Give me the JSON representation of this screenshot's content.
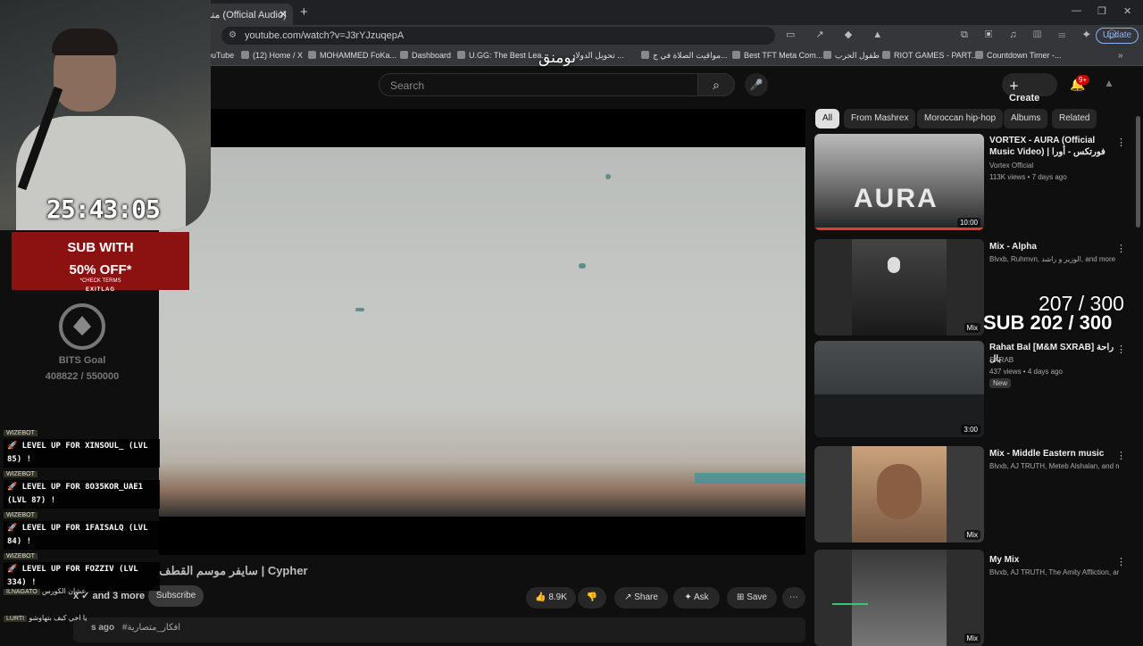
{
  "browser": {
    "tab_title": "متصارية (Official Audio)",
    "url": "youtube.com/watch?v=J3rYJzuqepA",
    "update_label": "Update",
    "bookmarks": [
      "ouTube",
      "(12) Home / X",
      "MOHAMMED FoKa...",
      "Dashboard",
      "U.GG: The Best Lea...",
      "تحويل الدولار ...",
      "مواقيت الصلاة في ج...",
      "Best TFT Meta Com...",
      "طقول الحرب",
      "RIOT GAMES - PART...",
      "Countdown Timer -..."
    ]
  },
  "youtube": {
    "search_placeholder": "Search",
    "create_label": "Create",
    "notif_count": "9+",
    "chips": [
      "All",
      "From Mashrex",
      "Moroccan hip-hop",
      "Albums",
      "Related"
    ],
    "video_title": "سايفر موسم القطف | Cypher",
    "channel_text": "and 3 more",
    "subscribe_label": "Subscribe",
    "likes": "8.9K",
    "share_label": "Share",
    "ask_label": "Ask",
    "save_label": "Save",
    "desc_prefix": "s ago",
    "desc_tag": "#افكار_متصارية"
  },
  "recommendations": [
    {
      "title": "VORTEX - AURA (Official Music Video) | فورتكس - أورا",
      "channel": "Vortex Official",
      "meta": "113K views • 7 days ago",
      "duration": "10:00",
      "thumb_text": "AURA"
    },
    {
      "title": "Mix - Alpha",
      "channel": "Blvxb, Ruhmvn, الوزير و راشد, and more",
      "meta": "",
      "duration": "Mix"
    },
    {
      "title": "Rahat Bal [M&M SXRAB] راحة بال",
      "channel": "SXRAB",
      "meta": "437 views • 4 days ago",
      "duration": "3:00",
      "tag": "New"
    },
    {
      "title": "Mix - Middle Eastern music",
      "channel": "Blvxb, AJ TRUTH, Meteb Alshalan, and m...",
      "meta": "",
      "duration": "Mix"
    },
    {
      "title": "My Mix",
      "channel": "Blvxb, AJ TRUTH, The Amity Affliction, an...",
      "meta": "",
      "duration": "Mix"
    }
  ],
  "overlay": {
    "timer": "25:43:05",
    "promo_big_1": "SUB WITH",
    "promo_big_2": "50% OFF*",
    "promo_small": "*CHECK TERMS",
    "promo_brand": "EXITLAG",
    "bits_label": "BITS Goal",
    "bits_value": "408822 / 550000",
    "sub_goal_1": "207 / 300",
    "sub_goal_2": "SUB 202 / 300",
    "arabic_top": "نومنق",
    "chat": [
      {
        "user": "WIZEBOT",
        "text": "🚀 LEVEL UP FOR XINSOUL_ (LVL 85) !"
      },
      {
        "user": "WIZEBOT",
        "text": "🚀 LEVEL UP FOR 8O35KOR_UAE1 (LVL 87) !"
      },
      {
        "user": "WIZEBOT",
        "text": "🚀 LEVEL UP FOR 1FAISALQ (LVL 84) !"
      },
      {
        "user": "WIZEBOT",
        "text": "🚀 LEVEL UP FOR FOZZIV (LVL 334) !"
      }
    ],
    "chat_small": [
      {
        "user": "ILNAGATO",
        "text": "عشان الكورس"
      },
      {
        "user": "LURTI",
        "text": "يا اخي كيف بتهاوشو"
      }
    ]
  },
  "icons": [
    "search-icon",
    "mic-icon",
    "bell-icon",
    "like-icon",
    "dislike-icon",
    "share-icon",
    "ask-icon",
    "save-icon",
    "more-icon"
  ]
}
